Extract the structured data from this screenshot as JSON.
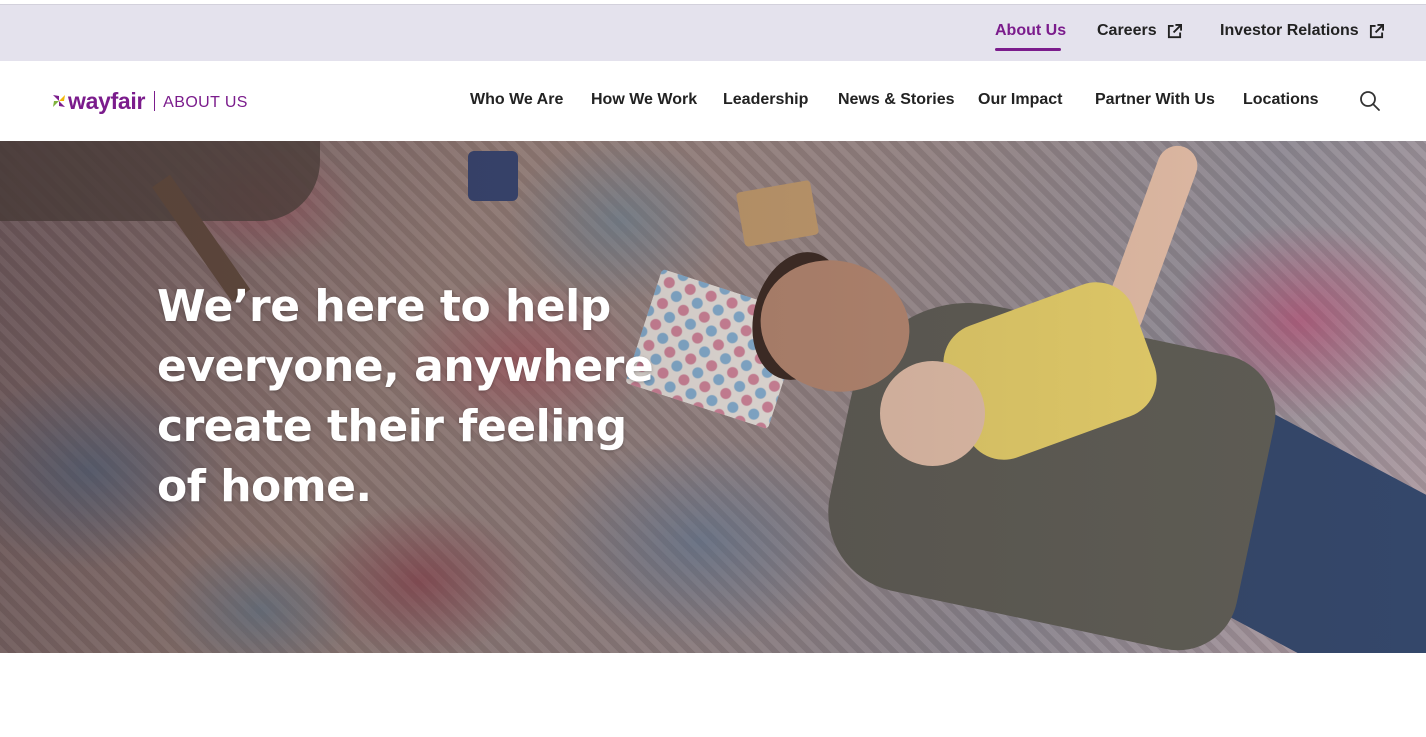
{
  "utility_nav": {
    "about": "About Us",
    "careers": "Careers",
    "investor": "Investor Relations"
  },
  "brand": {
    "wordmark": "wayfair",
    "section": "ABOUT US",
    "color": "#7b1c8c"
  },
  "main_nav": {
    "items": [
      "Who We Are",
      "How We Work",
      "Leadership",
      "News & Stories",
      "Our Impact",
      "Partner With Us",
      "Locations"
    ]
  },
  "hero": {
    "headline": "We’re here to help everyone, anywhere create their feeling of home."
  },
  "icons": {
    "search": "search-icon",
    "external": "external-link-icon"
  }
}
